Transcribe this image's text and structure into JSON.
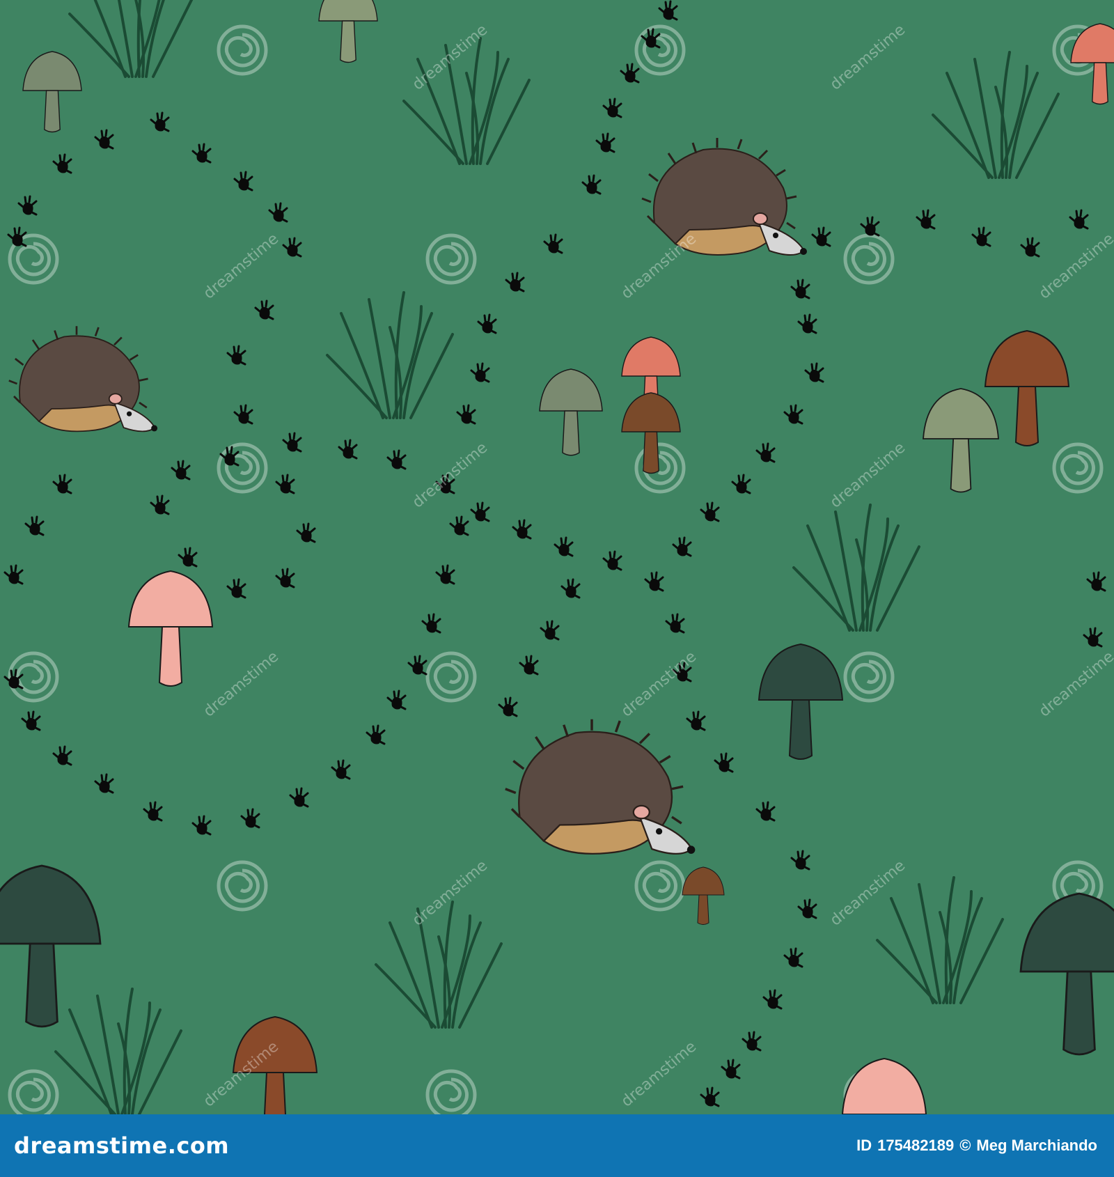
{
  "colors": {
    "background": "#3f8462",
    "footer": "#0f74b3",
    "grass": "#1b4b34",
    "track": "#0a0a0a",
    "hedgehog_spines": "#5a4a42",
    "hedgehog_body": "#c49a62"
  },
  "watermark": {
    "text": "dreamstime"
  },
  "footer": {
    "brand": "dreamstime.com",
    "id_label": "ID",
    "id_value": "175482189",
    "copyright": "©",
    "author": "Meg Marchiando"
  },
  "icons": [
    "dreamstime-swirl-icon",
    "hedgehog-icon",
    "mushroom-icon",
    "grass-tuft-icon",
    "footprint-icon"
  ]
}
